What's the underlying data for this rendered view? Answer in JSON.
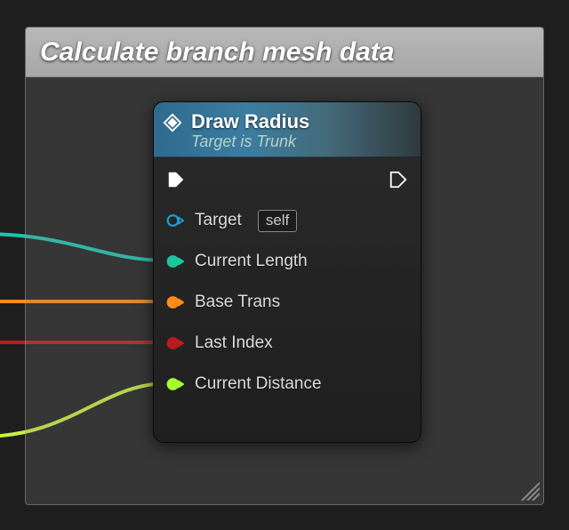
{
  "comment": {
    "title": "Calculate branch mesh data"
  },
  "node": {
    "title": "Draw Radius",
    "subtitle": "Target is Trunk",
    "exec_in_icon": "exec-in-icon",
    "exec_out_icon": "exec-out-icon",
    "pins": [
      {
        "label": "Target",
        "color": "#1aa3d8",
        "filled": false,
        "hollow": true,
        "value": "self"
      },
      {
        "label": "Current Length",
        "color": "#19c79b",
        "filled": true
      },
      {
        "label": "Base Trans",
        "color": "#ff8c1a",
        "filled": true
      },
      {
        "label": "Last Index",
        "color": "#b81c1c",
        "filled": true
      },
      {
        "label": "Current Distance",
        "color": "#a4ff2e",
        "filled": true
      }
    ]
  },
  "wires": [
    {
      "color": "#1ac7b0",
      "to_pin": 1
    },
    {
      "color": "#ff8c1a",
      "to_pin": 2
    },
    {
      "color": "#b81c1c",
      "to_pin": 3
    },
    {
      "color": "#c9f23c",
      "to_pin": 4
    }
  ]
}
